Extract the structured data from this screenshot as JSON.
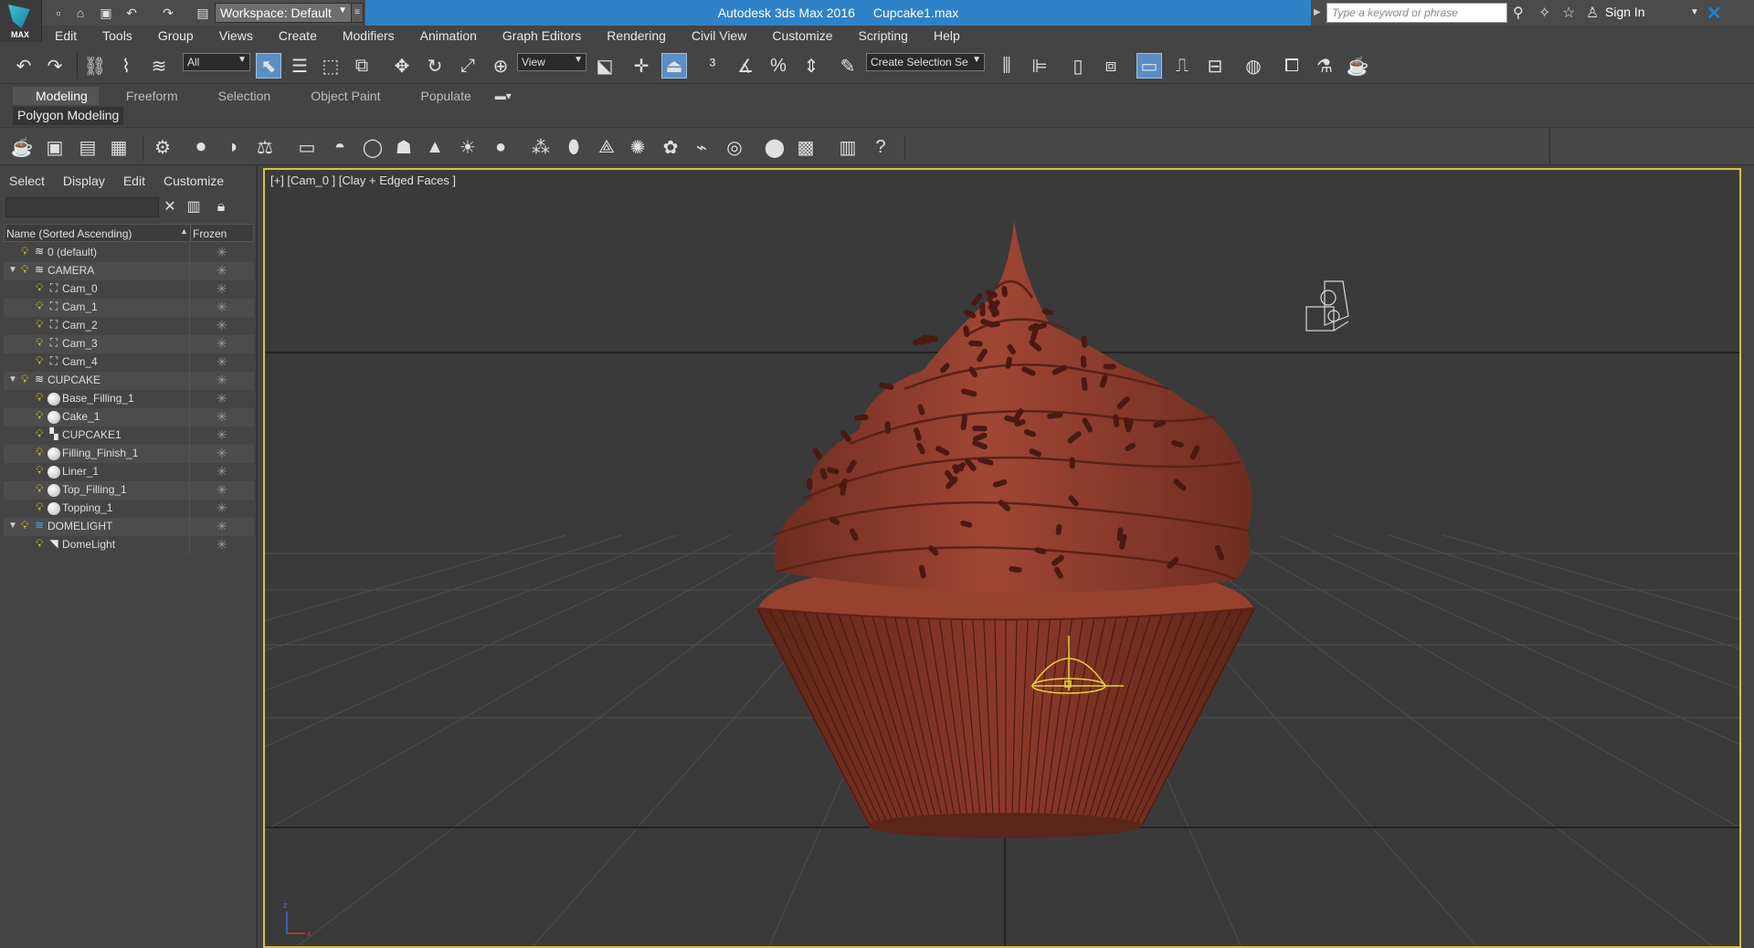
{
  "titlebar": {
    "logo_text": "MAX",
    "workspace": "Workspace: Default",
    "app_title": "Autodesk 3ds Max 2016",
    "file_name": "Cupcake1.max",
    "search_placeholder": "Type a keyword or phrase",
    "sign_in": "Sign In"
  },
  "menu": [
    "Edit",
    "Tools",
    "Group",
    "Views",
    "Create",
    "Modifiers",
    "Animation",
    "Graph Editors",
    "Rendering",
    "Civil View",
    "Customize",
    "Scripting",
    "Help"
  ],
  "maintoolbar": {
    "filter_value": "All",
    "ref_coord_value": "View",
    "selection_set_placeholder": "Create Selection Se"
  },
  "ribbon": {
    "tabs": [
      "Modeling",
      "Freeform",
      "Selection",
      "Object Paint",
      "Populate"
    ],
    "active_tab": "Modeling",
    "panel_label": "Polygon Modeling"
  },
  "explorer": {
    "tabs": [
      "Select",
      "Display",
      "Edit",
      "Customize"
    ],
    "col_name": "Name (Sorted Ascending)",
    "col_frozen": "Frozen",
    "rows": [
      {
        "label": "0 (default)",
        "level": 0,
        "type": "layer",
        "expand": ""
      },
      {
        "label": "CAMERA",
        "level": 0,
        "type": "layer",
        "expand": "▼"
      },
      {
        "label": "Cam_0",
        "level": 1,
        "type": "camera",
        "expand": ""
      },
      {
        "label": "Cam_1",
        "level": 1,
        "type": "camera",
        "expand": ""
      },
      {
        "label": "Cam_2",
        "level": 1,
        "type": "camera",
        "expand": ""
      },
      {
        "label": "Cam_3",
        "level": 1,
        "type": "camera",
        "expand": ""
      },
      {
        "label": "Cam_4",
        "level": 1,
        "type": "camera",
        "expand": ""
      },
      {
        "label": "CUPCAKE",
        "level": 0,
        "type": "layer",
        "expand": "▼"
      },
      {
        "label": "Base_Filling_1",
        "level": 1,
        "type": "geometry",
        "expand": ""
      },
      {
        "label": "Cake_1",
        "level": 1,
        "type": "geometry",
        "expand": ""
      },
      {
        "label": "CUPCAKE1",
        "level": 1,
        "type": "group",
        "expand": ""
      },
      {
        "label": "Filling_Finish_1",
        "level": 1,
        "type": "geometry",
        "expand": ""
      },
      {
        "label": "Liner_1",
        "level": 1,
        "type": "geometry",
        "expand": ""
      },
      {
        "label": "Top_Filling_1",
        "level": 1,
        "type": "geometry",
        "expand": ""
      },
      {
        "label": "Topping_1",
        "level": 1,
        "type": "geometry",
        "expand": ""
      },
      {
        "label": "DOMELIGHT",
        "level": 0,
        "type": "layer-active",
        "expand": "▼"
      },
      {
        "label": "DomeLight",
        "level": 1,
        "type": "light",
        "expand": ""
      }
    ]
  },
  "viewport": {
    "label": "[+] [Cam_0 ] [Clay + Edged Faces ]"
  },
  "colors": {
    "accent": "#2f82c8",
    "viewport_border": "#d5c23c",
    "frosting": "#8a3a2c",
    "liner": "#7a3325",
    "sprinkle": "#4a1a12"
  }
}
